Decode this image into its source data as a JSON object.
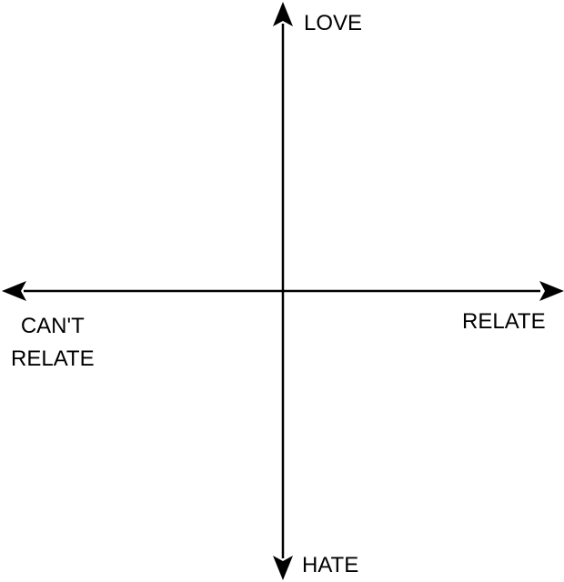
{
  "diagram": {
    "type": "quadrant-axes",
    "line_color": "#000000",
    "labels": {
      "top": "LOVE",
      "bottom": "HATE",
      "right": "RELATE",
      "left_line1": "CAN'T",
      "left_line2": "RELATE"
    }
  }
}
